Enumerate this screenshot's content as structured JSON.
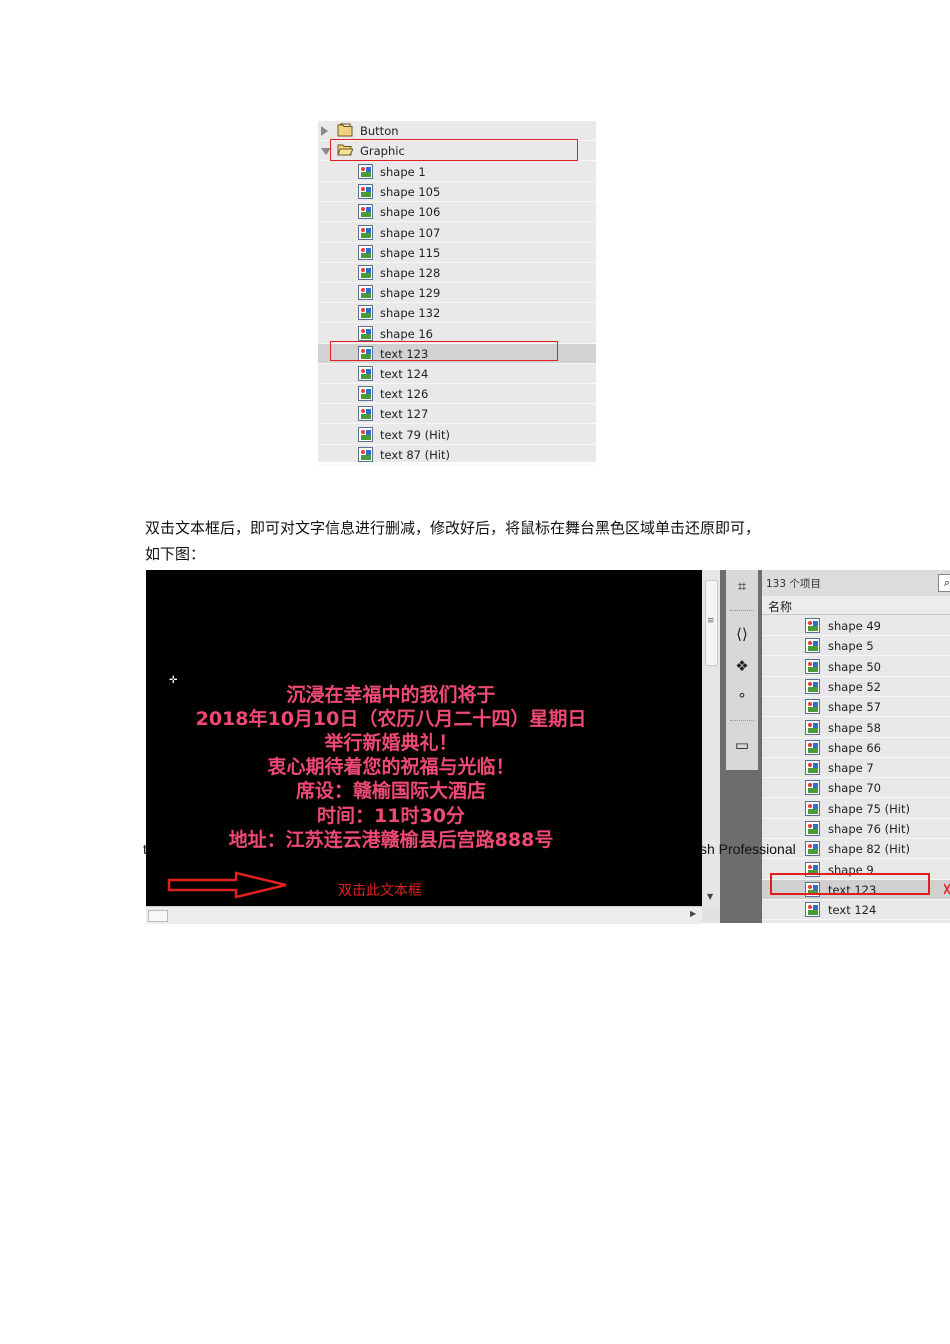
{
  "library_top": {
    "folders": [
      {
        "label": "Button",
        "expanded": false
      },
      {
        "label": "Graphic",
        "expanded": true
      }
    ],
    "items": [
      "shape 1",
      "shape 105",
      "shape 106",
      "shape 107",
      "shape 115",
      "shape 128",
      "shape 129",
      "shape 132",
      "shape 16",
      "text 123",
      "text 124",
      "text 126",
      "text 127",
      "text 79 (Hit)",
      "text 87 (Hit)"
    ],
    "selected": "text 123"
  },
  "instruction": {
    "line1": "双击文本框后，即可对文字信息进行删减，修改好后，将鼠标在舞台黑色区域单击还原即可，",
    "line2": "如下图："
  },
  "stage": {
    "invitation": [
      "沉浸在幸福中的我们将于",
      "2018年10月10日（农历八月二十四）星期日",
      "举行新婚典礼！",
      "衷心期待着您的祝福与光临！",
      "席设：赣榆国际大酒店",
      "时间：11时30分",
      "地址：江苏连云港赣榆县后宫路888号"
    ],
    "annotation": "双击此文本框",
    "text_color": "#ef4a74",
    "annotation_color": "#e02020"
  },
  "library_side": {
    "count": "133 个项目",
    "column": "名称",
    "items": [
      "shape 49",
      "shape 5",
      "shape 50",
      "shape 52",
      "shape 57",
      "shape 58",
      "shape 66",
      "shape 7",
      "shape 70",
      "shape 75 (Hit)",
      "shape 76 (Hit)",
      "shape 82 (Hit)",
      "shape 9",
      "text 123",
      "text 124"
    ],
    "selected": "text 123"
  },
  "overlay_text": "sh Professional",
  "stray_char": "t"
}
